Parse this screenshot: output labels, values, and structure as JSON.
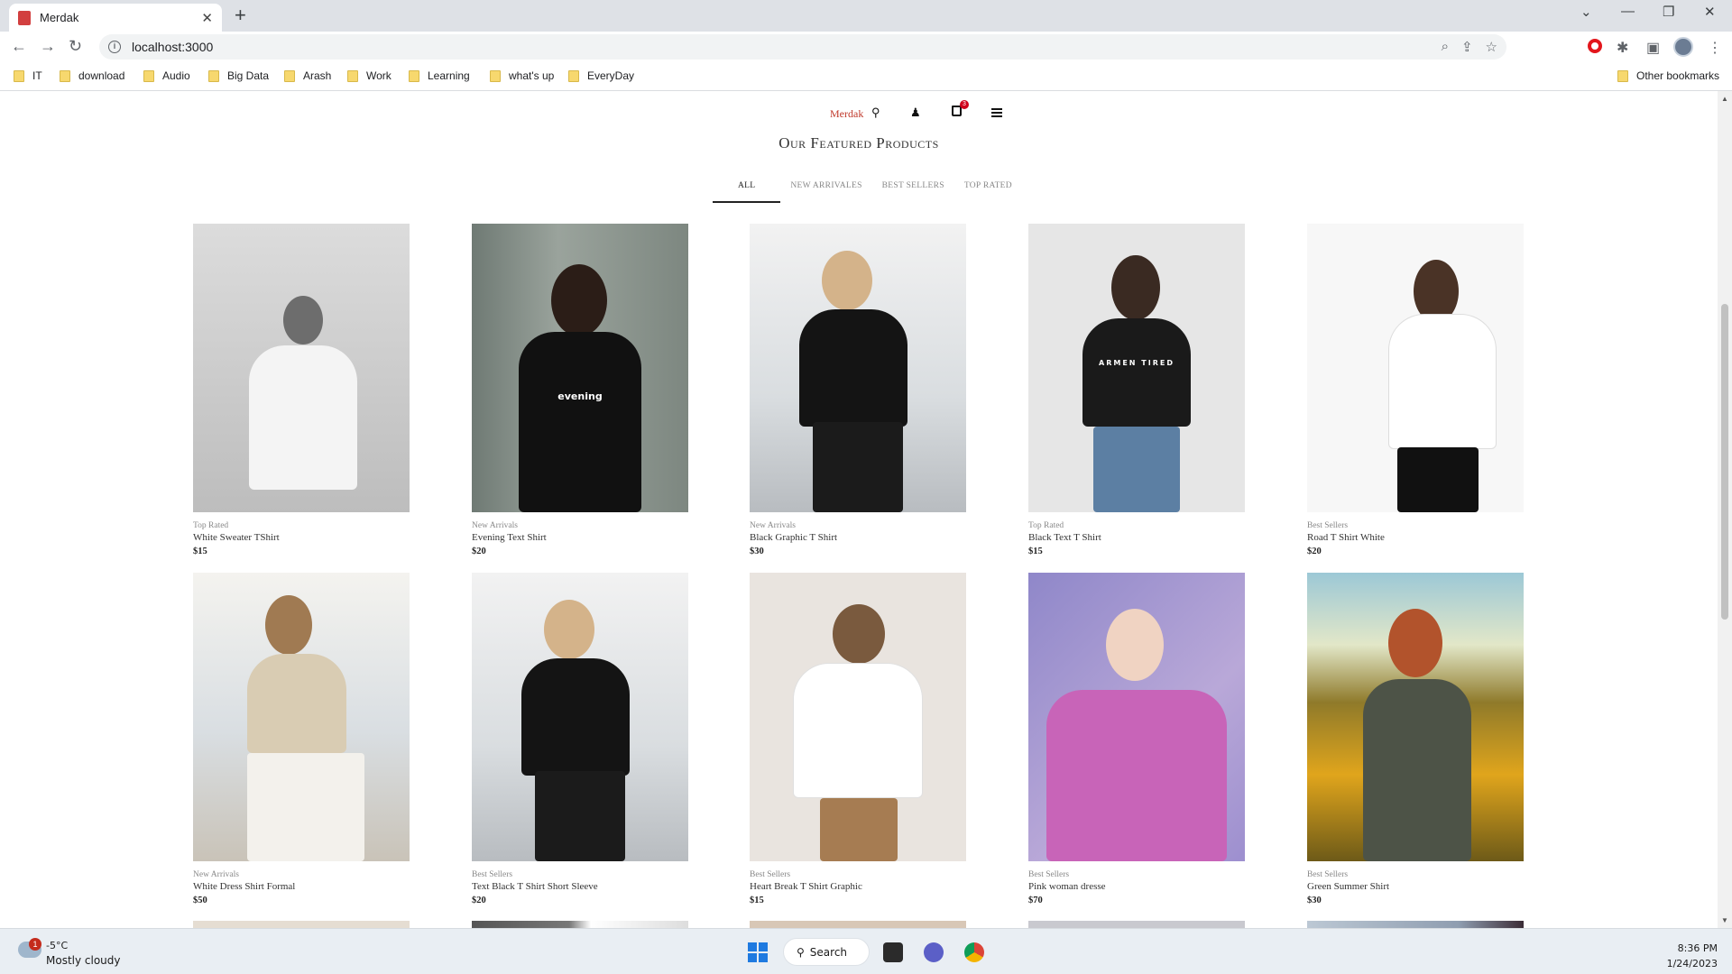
{
  "browser": {
    "tab_title": "Merdak",
    "tab_close": "✕",
    "new_tab": "+",
    "url": "localhost:3000",
    "bookmarks": [
      "IT",
      "download",
      "Audio",
      "Big Data",
      "Arash",
      "Work",
      "Learning",
      "what's up",
      "EveryDay"
    ],
    "other_bookmarks": "Other bookmarks"
  },
  "site": {
    "brand": "Merdak",
    "cart_count": "3",
    "section_title": "Our Featured Products",
    "tabs": [
      "ALL",
      "NEW ARRIVALES",
      "BEST SELLERS",
      "TOP RATED"
    ],
    "active_tab": "ALL"
  },
  "products": [
    {
      "category": "Top Rated",
      "name": "White Sweater TShirt",
      "price": "$15"
    },
    {
      "category": "New Arrivals",
      "name": "Evening Text Shirt",
      "price": "$20",
      "shirt_text": "evening"
    },
    {
      "category": "New Arrivals",
      "name": "Black Graphic T Shirt",
      "price": "$30"
    },
    {
      "category": "Top Rated",
      "name": "Black Text T Shirt",
      "price": "$15",
      "shirt_text": "ARMEN TIRED"
    },
    {
      "category": "Best Sellers",
      "name": "Road T Shirt White",
      "price": "$20"
    },
    {
      "category": "New Arrivals",
      "name": "White Dress Shirt Formal",
      "price": "$50"
    },
    {
      "category": "Best Sellers",
      "name": "Text Black T Shirt Short Sleeve",
      "price": "$20"
    },
    {
      "category": "Best Sellers",
      "name": "Heart Break T Shirt Graphic",
      "price": "$15"
    },
    {
      "category": "Best Sellers",
      "name": "Pink woman dresse",
      "price": "$70"
    },
    {
      "category": "Best Sellers",
      "name": "Green Summer Shirt",
      "price": "$30"
    }
  ],
  "taskbar": {
    "weather_badge": "1",
    "temperature": "-5°C",
    "weather": "Mostly cloudy",
    "search_label": "Search",
    "time": "8:36 PM",
    "date": "1/24/2023"
  },
  "icons": {
    "search": "search-icon",
    "user": "user-icon",
    "cart": "cart-icon",
    "menu": "menu-icon"
  },
  "colors": {
    "brand": "#c0392b",
    "badge": "#d0021b"
  }
}
